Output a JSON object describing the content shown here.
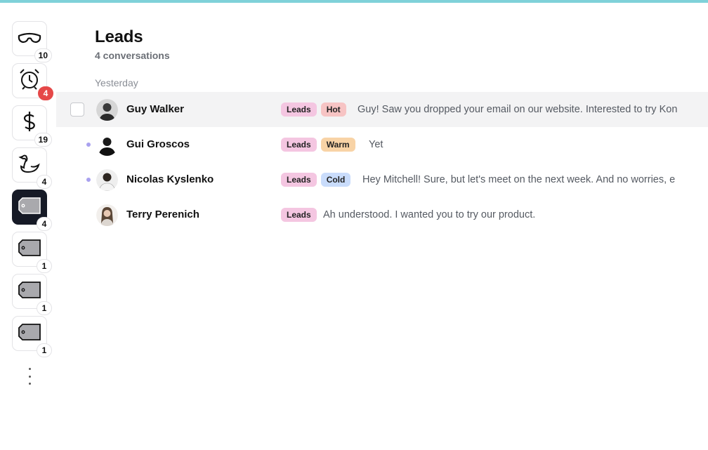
{
  "header": {
    "title": "Leads",
    "subtitle": "4 conversations"
  },
  "group_label": "Yesterday",
  "rail": {
    "items": [
      {
        "icon": "goggles-icon",
        "count": "10"
      },
      {
        "icon": "alarm-clock-icon",
        "count": "4",
        "badge_color": "#e54848"
      },
      {
        "icon": "dollar-icon",
        "count": "19"
      },
      {
        "icon": "swan-icon",
        "count": "4"
      },
      {
        "icon": "tag-icon",
        "count": "4",
        "active": true
      },
      {
        "icon": "tag-icon",
        "count": "1"
      },
      {
        "icon": "tag-icon",
        "count": "1"
      },
      {
        "icon": "tag-icon",
        "count": "1"
      }
    ],
    "more_icon": "more-vertical-icon"
  },
  "conversations": [
    {
      "name": "Guy Walker",
      "tags": [
        "Leads",
        "Hot"
      ],
      "preview": "Guy! Saw you dropped your email on our website. Interested to try Kon",
      "unread": false
    },
    {
      "name": "Gui Groscos",
      "tags": [
        "Leads",
        "Warm"
      ],
      "preview": "Yet",
      "unread": true
    },
    {
      "name": "Nicolas Kyslenko",
      "tags": [
        "Leads",
        "Cold"
      ],
      "preview": "Hey Mitchell! Sure, but let's meet on the next week. And no worries, e",
      "unread": true
    },
    {
      "name": "Terry Perenich",
      "tags": [
        "Leads"
      ],
      "preview": "Ah understood. I wanted you to try our product.",
      "unread": false
    }
  ],
  "colors": {
    "accent_bar": "#7fd1d9",
    "unread_dot": "#a9a1ef",
    "tag_leads": "#f4c6e1",
    "tag_hot": "#f7c4c4",
    "tag_warm": "#f8d3a6",
    "tag_cold": "#c9dcfb"
  }
}
